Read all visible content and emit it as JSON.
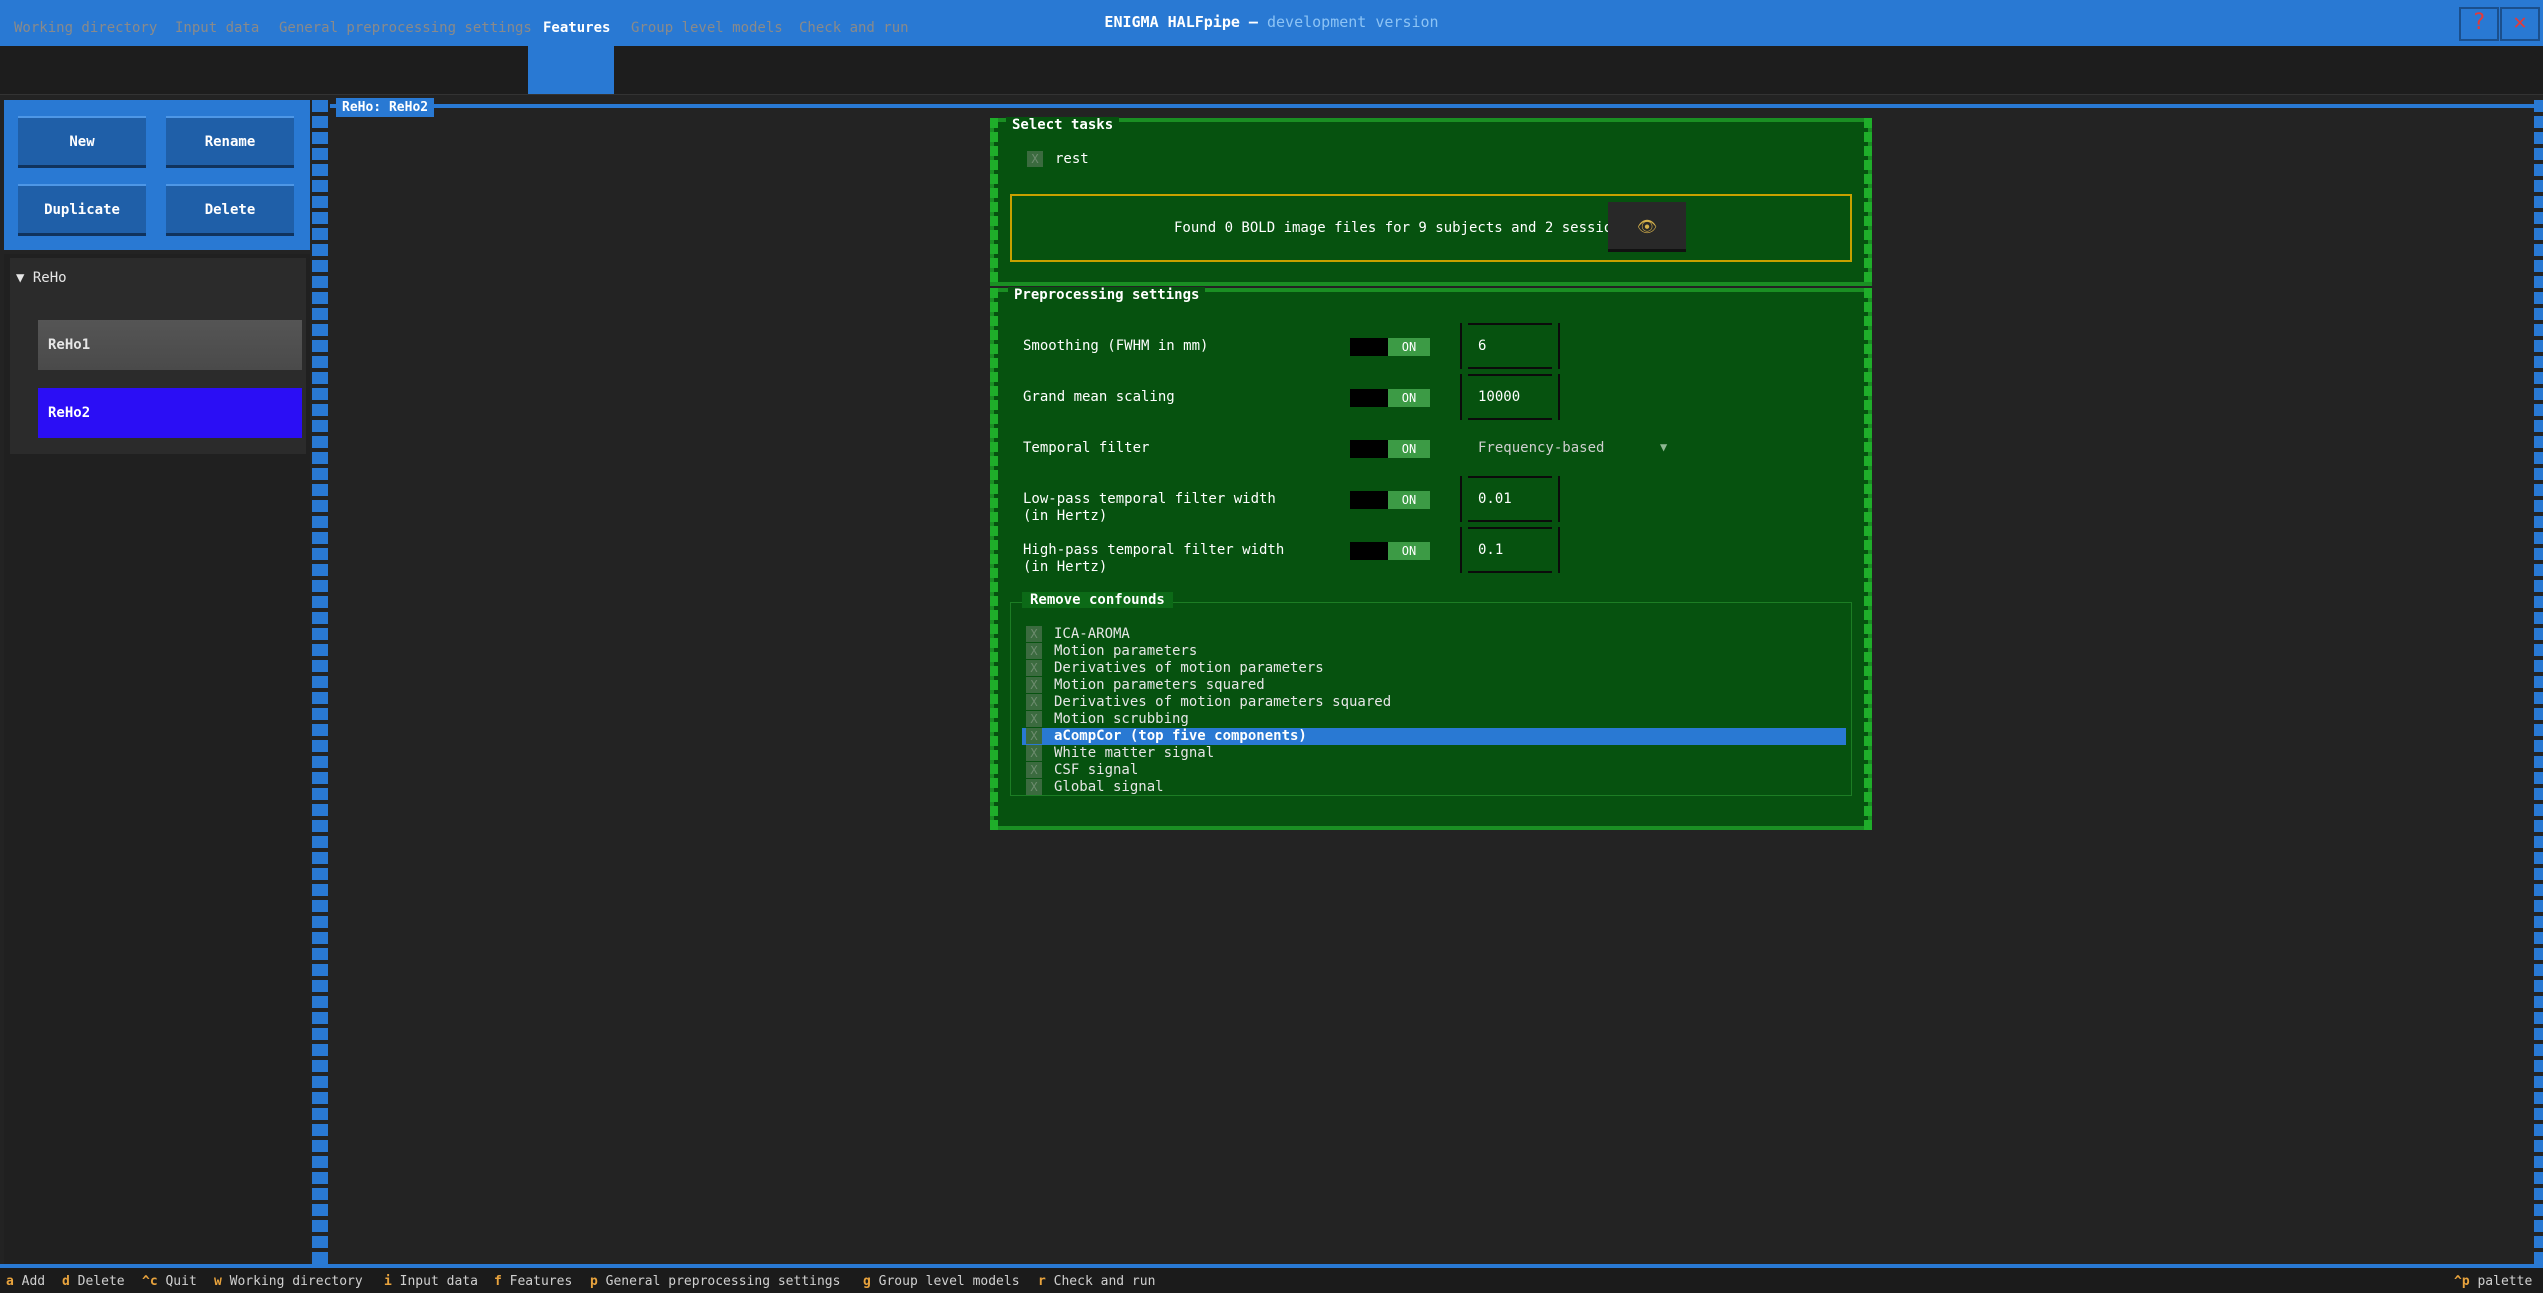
{
  "window": {
    "title": "ENIGMA HALFpipe",
    "separator": "—",
    "subtitle": "development version",
    "help_label": "?",
    "close_label": "✕"
  },
  "tabs": [
    {
      "label": "Working directory"
    },
    {
      "label": "Input data"
    },
    {
      "label": "General preprocessing settings"
    },
    {
      "label": "Features"
    },
    {
      "label": "Group level models"
    },
    {
      "label": "Check and run"
    }
  ],
  "sidebar": {
    "buttons": {
      "new": "New",
      "rename": "Rename",
      "duplicate": "Duplicate",
      "delete": "Delete"
    },
    "group": "▼ ReHo",
    "features": [
      "ReHo1",
      "ReHo2"
    ]
  },
  "main": {
    "label": "ReHo: ReHo2",
    "tasks": {
      "title": "Select tasks",
      "items": [
        {
          "label": "rest",
          "check": "X"
        }
      ],
      "found_text": "Found 0 BOLD image files for 9 subjects and 2 sessions",
      "eye_button": "👁"
    },
    "preprocessing": {
      "title": "Preprocessing settings",
      "toggle_label": "ON",
      "rows": [
        {
          "label": "Smoothing (FWHM in mm)",
          "value": "6"
        },
        {
          "label": "Grand mean scaling",
          "value": "10000"
        },
        {
          "label": "Temporal filter",
          "value": "Frequency-based"
        },
        {
          "label": "Low-pass temporal filter width",
          "label2": "(in Hertz)",
          "value": "0.01"
        },
        {
          "label": "High-pass temporal filter width",
          "label2": "(in Hertz)",
          "value": "0.1"
        }
      ],
      "select_arrow": "▼"
    },
    "confounds": {
      "title": "Remove confounds",
      "items": [
        "ICA-AROMA",
        "Motion parameters",
        "Derivatives of motion parameters",
        "Motion parameters squared",
        "Derivatives of motion parameters squared",
        "Motion scrubbing",
        "aCompCor (top five components)",
        "White matter signal",
        "CSF signal",
        "Global signal"
      ],
      "check": "X",
      "selected_index": 6
    }
  },
  "footer": {
    "keys": [
      {
        "key": "a",
        "desc": "Add"
      },
      {
        "key": "d",
        "desc": "Delete"
      },
      {
        "key": "^c",
        "desc": "Quit"
      },
      {
        "key": "w",
        "desc": "Working directory"
      },
      {
        "key": "i",
        "desc": "Input data"
      },
      {
        "key": "f",
        "desc": "Features"
      },
      {
        "key": "p",
        "desc": "General preprocessing settings"
      },
      {
        "key": "g",
        "desc": "Group level models"
      },
      {
        "key": "r",
        "desc": "Check and run"
      }
    ],
    "palette": {
      "key": "^p",
      "desc": "palette"
    }
  },
  "colors": {
    "accent": "#2979d3",
    "panel": "#06520f",
    "selected": "#2b0ef5",
    "key": "#e8a33d"
  }
}
